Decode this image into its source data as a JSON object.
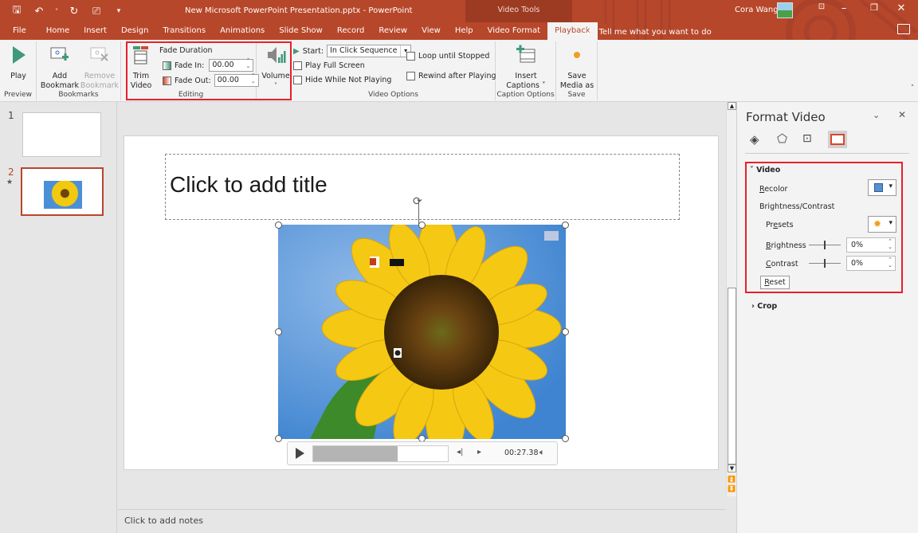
{
  "window": {
    "doc_title": "New Microsoft PowerPoint Presentation.pptx  -  PowerPoint",
    "context_group": "Video Tools",
    "user_name": "Cora Wang",
    "qat_icons": [
      "save-icon",
      "undo-icon",
      "undo-dropdown-icon",
      "redo-icon",
      "presenter-icon",
      "customize-qat-icon"
    ]
  },
  "tabs": [
    "File",
    "Home",
    "Insert",
    "Design",
    "Transitions",
    "Animations",
    "Slide Show",
    "Record",
    "Review",
    "View",
    "Help",
    "Video Format",
    "Playback"
  ],
  "active_tab": "Playback",
  "tell_me": "Tell me what you want to do",
  "ribbon": {
    "preview": {
      "play": "Play",
      "label": "Preview"
    },
    "bookmarks": {
      "add": "Add\nBookmark",
      "add1": "Add",
      "add2": "Bookmark",
      "remove1": "Remove",
      "remove2": "Bookmark",
      "label": "Bookmarks"
    },
    "editing": {
      "trim1": "Trim",
      "trim2": "Video",
      "fade_duration": "Fade Duration",
      "fade_in_label": "Fade In:",
      "fade_in_value": "00.00",
      "fade_out_label": "Fade Out:",
      "fade_out_value": "00.00",
      "label": "Editing"
    },
    "volume": {
      "label": "Volume"
    },
    "video_options": {
      "start_label": "Start:",
      "start_value": "In Click Sequence",
      "play_full_screen": "Play Full Screen",
      "hide_while_not_playing": "Hide While Not Playing",
      "loop_until_stopped": "Loop until Stopped",
      "rewind_after_playing": "Rewind after Playing",
      "label": "Video Options"
    },
    "captions": {
      "insert1": "Insert",
      "insert2": "Captions ˅",
      "label": "Caption Options"
    },
    "save": {
      "save1": "Save",
      "save2": "Media as",
      "label": "Save"
    }
  },
  "slides": [
    {
      "number": "1",
      "has_video": false
    },
    {
      "number": "2",
      "has_video": true,
      "has_animation": true,
      "star": "★"
    }
  ],
  "slide": {
    "title_placeholder": "Click to add title",
    "video_time": "00:27.38",
    "video_progress": 0.63
  },
  "notes_placeholder": "Click to add notes",
  "format_pane": {
    "title": "Format Video",
    "tab_icons": [
      "fill-line-icon",
      "effects-icon",
      "size-properties-icon",
      "video-icon"
    ],
    "video_section": "Video",
    "recolor": "Recolor",
    "brightness_contrast": "Brightness/Contrast",
    "presets": "Presets",
    "brightness": "Brightness",
    "brightness_value": "0%",
    "contrast": "Contrast",
    "contrast_value": "0%",
    "reset": "Reset",
    "crop_section": "Crop"
  },
  "colors": {
    "accent": "#b7472a",
    "highlight": "#e8202a",
    "ribbon_bg": "#f3f3f3"
  }
}
